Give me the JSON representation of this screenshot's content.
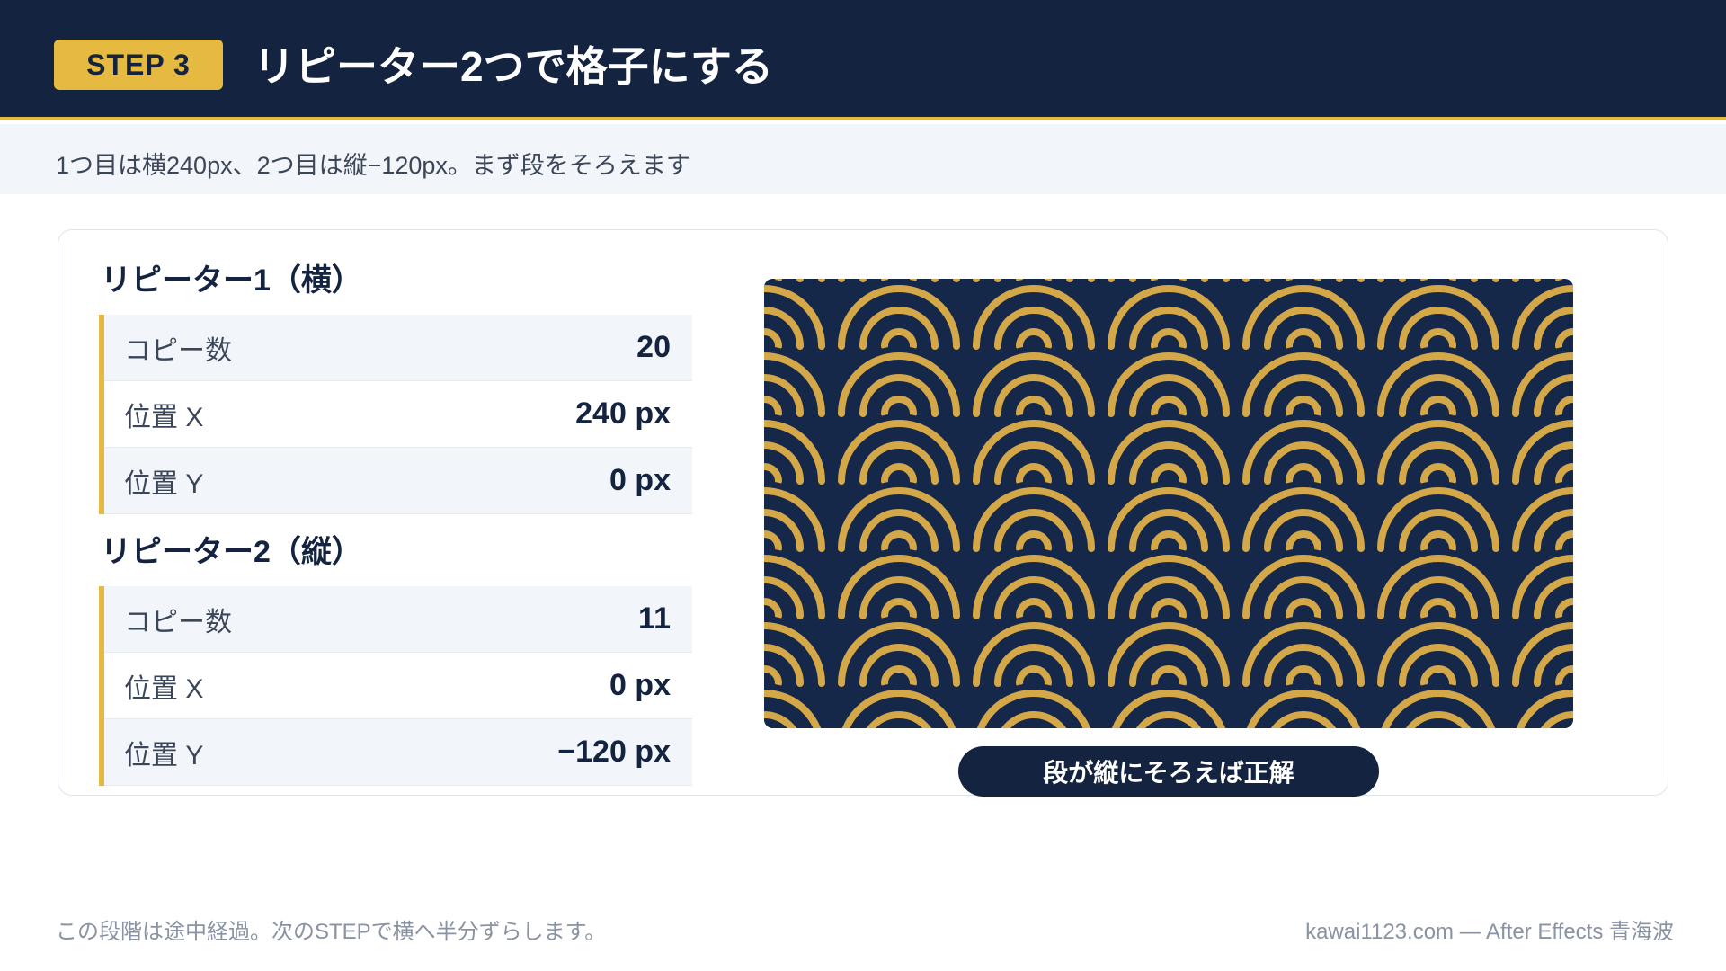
{
  "header": {
    "step_label": "STEP 3",
    "title": "リピーター2つで格子にする"
  },
  "subtitle": "1つ目は横240px、2つ目は縦−120px。まず段をそろえます",
  "repeater1": {
    "title": "リピーター1（横）",
    "rows": [
      {
        "label": "コピー数",
        "value": "20"
      },
      {
        "label": "位置 X",
        "value": "240 px"
      },
      {
        "label": "位置 Y",
        "value": "0 px"
      }
    ]
  },
  "repeater2": {
    "title": "リピーター2（縦）",
    "rows": [
      {
        "label": "コピー数",
        "value": "11"
      },
      {
        "label": "位置 X",
        "value": "0 px"
      },
      {
        "label": "位置 Y",
        "value": "−120 px"
      }
    ]
  },
  "preview": {
    "pattern": "seigaiha-grid-aligned",
    "background_color": "#15284a",
    "stroke_color": "#d4a849",
    "caption": "段が縦にそろえば正解"
  },
  "footer": {
    "note": "この段階は途中経過。次のSTEPで横へ半分ずらします。",
    "credit": "kawai1123.com — After Effects 青海波"
  },
  "colors": {
    "navy": "#14233f",
    "gold": "#e6b940",
    "band": "#f2f5fa"
  }
}
